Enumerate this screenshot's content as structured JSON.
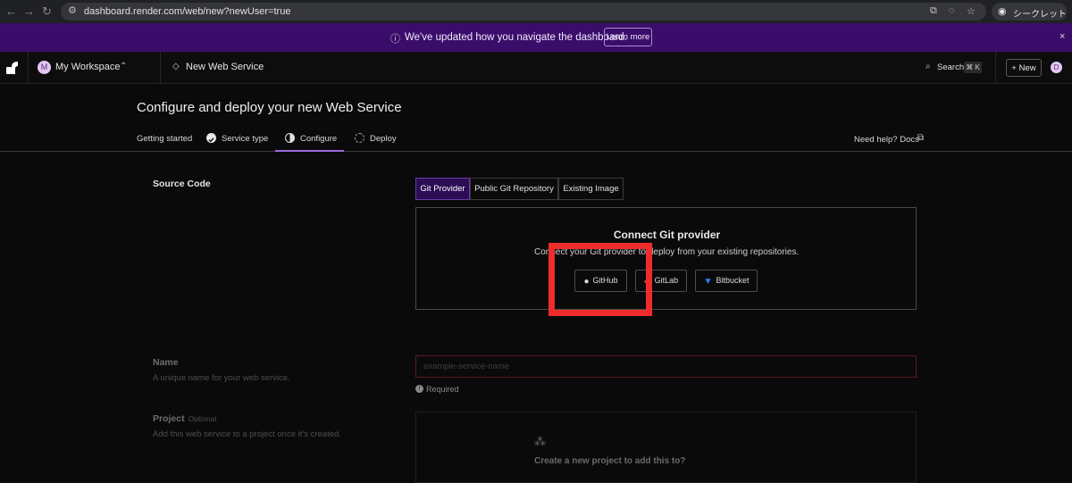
{
  "browser": {
    "url": "dashboard.render.com/web/new?newUser=true",
    "incognito_label": "シークレット"
  },
  "banner": {
    "message": "We've updated how you navigate the dashboard.",
    "learn_more": "Learn more"
  },
  "appbar": {
    "workspace_initial": "M",
    "workspace_name": "My Workspace",
    "page_name": "New Web Service",
    "search_label": "Search",
    "search_shortcut": "⌘ K",
    "new_label": "New",
    "user_initial": "D"
  },
  "page": {
    "title": "Configure and deploy your new Web Service",
    "steps": [
      "Getting started",
      "Service type",
      "Configure",
      "Deploy"
    ],
    "help": "Need help? Docs"
  },
  "source": {
    "label": "Source Code",
    "tabs": [
      "Git Provider",
      "Public Git Repository",
      "Existing Image"
    ],
    "active_tab": "Git Provider",
    "connect_title": "Connect Git provider",
    "connect_sub": "Connect your Git provider to deploy from your existing repositories.",
    "providers": [
      "GitHub",
      "GitLab",
      "Bitbucket"
    ]
  },
  "name": {
    "label": "Name",
    "sub": "A unique name for your web service.",
    "placeholder": "example-service-name",
    "required": "Required"
  },
  "project": {
    "label": "Project",
    "optional": "Optional",
    "sub": "Add this web service to a project once it's created.",
    "create_title": "Create a new project to add this to?"
  },
  "colors": {
    "banner": "#3b0d6a",
    "accent": "#9b6ddf",
    "highlight": "#ee2c2c"
  }
}
